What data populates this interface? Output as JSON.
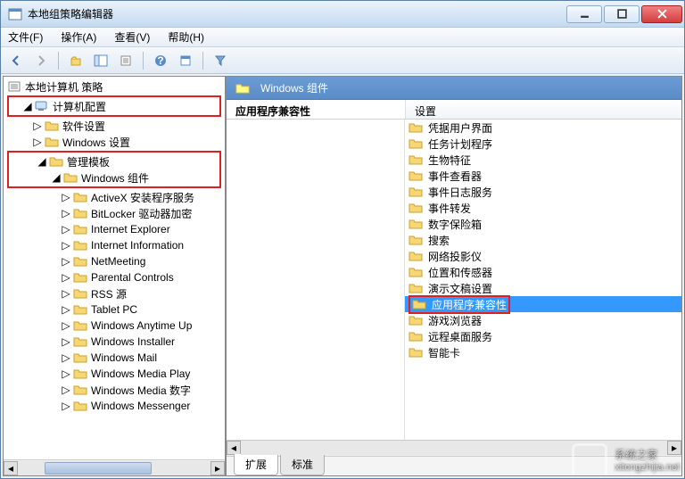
{
  "window": {
    "title": "本地组策略编辑器"
  },
  "menu": {
    "file": "文件(F)",
    "action": "操作(A)",
    "view": "查看(V)",
    "help": "帮助(H)"
  },
  "tree": {
    "root": "本地计算机 策略",
    "computer_config": "计算机配置",
    "software_settings": "软件设置",
    "windows_settings": "Windows 设置",
    "admin_templates": "管理模板",
    "windows_components": "Windows 组件",
    "items": [
      "ActiveX 安装程序服务",
      "BitLocker 驱动器加密",
      "Internet Explorer",
      "Internet Information",
      "NetMeeting",
      "Parental Controls",
      "RSS 源",
      "Tablet PC",
      "Windows Anytime Up",
      "Windows Installer",
      "Windows Mail",
      "Windows Media Play",
      "Windows Media 数字",
      "Windows Messenger"
    ]
  },
  "right": {
    "header": "Windows 组件",
    "category": "应用程序兼容性",
    "settings_col": "设置",
    "items": [
      "凭据用户界面",
      "任务计划程序",
      "生物特征",
      "事件查看器",
      "事件日志服务",
      "事件转发",
      "数字保险箱",
      "搜索",
      "网络投影仪",
      "位置和传感器",
      "演示文稿设置",
      "应用程序兼容性",
      "游戏浏览器",
      "远程桌面服务",
      "智能卡"
    ],
    "selected_index": 11
  },
  "tabs": {
    "extended": "扩展",
    "standard": "标准"
  },
  "watermark": {
    "name": "系统之家",
    "url": "xitongzhijia.net"
  }
}
